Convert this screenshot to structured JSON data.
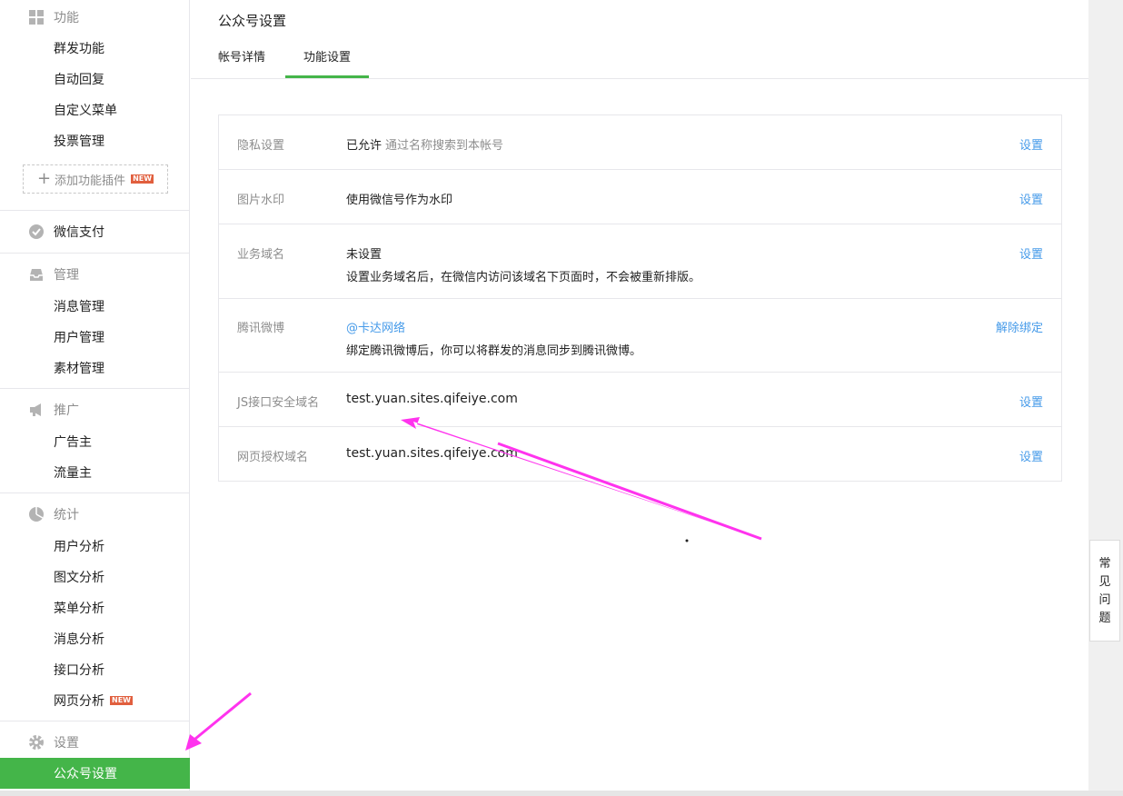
{
  "sidebar": {
    "sections": [
      {
        "title": "功能",
        "icon": "grid-icon",
        "items": [
          "群发功能",
          "自动回复",
          "自定义菜单",
          "投票管理"
        ]
      },
      {
        "title": "微信支付",
        "icon": "wechat-pay-icon",
        "items": []
      },
      {
        "title": "管理",
        "icon": "inbox-icon",
        "items": [
          "消息管理",
          "用户管理",
          "素材管理"
        ]
      },
      {
        "title": "推广",
        "icon": "megaphone-icon",
        "items": [
          "广告主",
          "流量主"
        ]
      },
      {
        "title": "统计",
        "icon": "pie-chart-icon",
        "items": [
          "用户分析",
          "图文分析",
          "菜单分析",
          "消息分析",
          "接口分析",
          "网页分析"
        ]
      },
      {
        "title": "设置",
        "icon": "gear-icon",
        "items": [
          "公众号设置"
        ]
      }
    ],
    "add_plugin": "添加功能插件",
    "new_badge": "NEW"
  },
  "main": {
    "title": "公众号设置",
    "tabs": [
      {
        "label": "帐号详情",
        "active": false
      },
      {
        "label": "功能设置",
        "active": true
      }
    ],
    "rows": [
      {
        "label": "隐私设置",
        "value": "已允许",
        "hint": "通过名称搜索到本帐号",
        "action": "设置"
      },
      {
        "label": "图片水印",
        "value": "使用微信号作为水印",
        "action": "设置"
      },
      {
        "label": "业务域名",
        "value": "未设置",
        "sub": "设置业务域名后，在微信内访问该域名下页面时，不会被重新排版。",
        "action": "设置"
      },
      {
        "label": "腾讯微博",
        "value": "@卡达网络",
        "sub": "绑定腾讯微博后，你可以将群发的消息同步到腾讯微博。",
        "action": "解除绑定"
      },
      {
        "label": "JS接口安全域名",
        "value": "test.yuan.sites.qifeiye.com",
        "action": "设置"
      },
      {
        "label": "网页授权域名",
        "value": "test.yuan.sites.qifeiye.com",
        "action": "设置"
      }
    ]
  },
  "faq": [
    "常",
    "见",
    "问",
    "题"
  ],
  "colors": {
    "accent": "#44b549",
    "link": "#459ae9",
    "annotation": "#ff33ee"
  }
}
